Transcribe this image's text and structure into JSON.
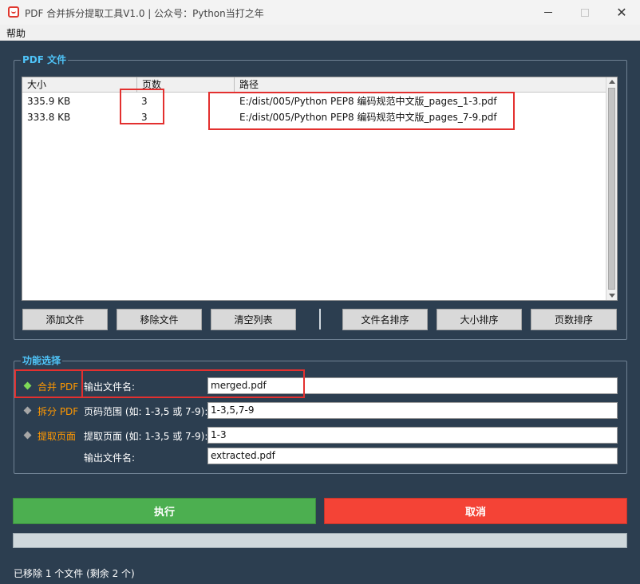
{
  "window": {
    "title": "PDF 合并拆分提取工具V1.0 | 公众号：Python当打之年",
    "minimize_glyph": "—",
    "close_glyph": "✕"
  },
  "menu": {
    "items": [
      "帮助"
    ]
  },
  "file_group": {
    "title": "PDF 文件",
    "columns": [
      "大小",
      "页数",
      "路径"
    ],
    "rows": [
      {
        "size": "335.9 KB",
        "pages": "3",
        "path": "E:/dist/005/Python PEP8 编码规范中文版_pages_1-3.pdf"
      },
      {
        "size": "333.8 KB",
        "pages": "3",
        "path": "E:/dist/005/Python PEP8 编码规范中文版_pages_7-9.pdf"
      }
    ],
    "buttons": {
      "add": "添加文件",
      "remove": "移除文件",
      "clear": "清空列表",
      "sort_name": "文件名排序",
      "sort_size": "大小排序",
      "sort_pages": "页数排序"
    }
  },
  "func_group": {
    "title": "功能选择",
    "merge": {
      "label": "合并 PDF",
      "field_label": "输出文件名:",
      "value": "merged.pdf",
      "selected": true
    },
    "split": {
      "label": "拆分 PDF",
      "field_label": "页码范围 (如: 1-3,5 或 7-9):",
      "value": "1-3,5,7-9",
      "selected": false
    },
    "extract": {
      "label": "提取页面",
      "field_label": "提取页面 (如: 1-3,5 或 7-9):",
      "value": "1-3",
      "output_label": "输出文件名:",
      "output_value": "extracted.pdf",
      "selected": false
    }
  },
  "actions": {
    "run": "执行",
    "cancel": "取消"
  },
  "progress": {
    "percent": 0
  },
  "status": "已移除 1 个文件 (剩余 2 个)",
  "colors": {
    "background": "#2c3e50",
    "group_title": "#4fc3f7",
    "mode_active": "#7ed957",
    "mode_label": "#ff9800",
    "run": "#4caf50",
    "cancel": "#f44336",
    "annotation": "#e3302f"
  },
  "icons": {
    "app": "pdf-app-icon",
    "mode_selected": "diamond-filled-icon",
    "mode_unselected": "diamond-gray-icon"
  }
}
